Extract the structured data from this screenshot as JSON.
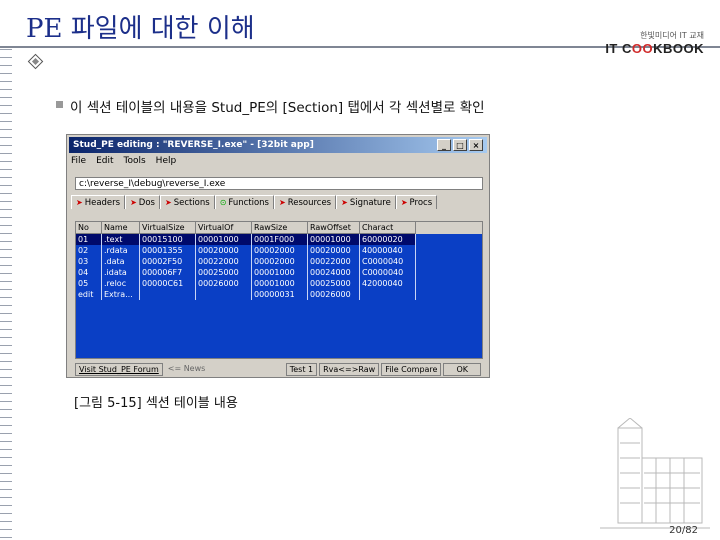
{
  "slide": {
    "title": "PE 파일에 대한 이해",
    "logo_sub": "한빛미디어 IT 교재",
    "logo_main_1": "IT C",
    "logo_main_o": "OO",
    "logo_main_2": "KBOOK",
    "bullet": "이 섹션 테이블의 내용을 Stud_PE의 [Section] 탭에서 각 섹션별로 확인",
    "caption": "[그림 5-15] 섹션 테이블 내용",
    "page": "20/82"
  },
  "window": {
    "title": "Stud_PE editing : \"REVERSE_I.exe\" - [32bit app]",
    "menu": [
      "File",
      "Edit",
      "Tools",
      "Help"
    ],
    "path": "c:\\reverse_I\\debug\\reverse_I.exe",
    "tabs": [
      {
        "icon": "headers-icon",
        "label": "Headers"
      },
      {
        "icon": "dos-icon",
        "label": "Dos"
      },
      {
        "icon": "sections-icon",
        "label": "Sections"
      },
      {
        "icon": "functions-icon",
        "label": "Functions"
      },
      {
        "icon": "resources-icon",
        "label": "Resources"
      },
      {
        "icon": "signature-icon",
        "label": "Signature"
      },
      {
        "icon": "procs-icon",
        "label": "Procs"
      }
    ],
    "columns": [
      "No",
      "Name",
      "VirtualSize",
      "VirtualOf",
      "RawSize",
      "RawOffset",
      "Charact"
    ],
    "rows": [
      [
        "01",
        ".text",
        "00015100",
        "00001000",
        "0001F000",
        "00001000",
        "60000020"
      ],
      [
        "02",
        ".rdata",
        "00001355",
        "00020000",
        "00002000",
        "00020000",
        "40000040"
      ],
      [
        "03",
        ".data",
        "00002F50",
        "00022000",
        "00002000",
        "00022000",
        "C0000040"
      ],
      [
        "04",
        ".idata",
        "000006F7",
        "00025000",
        "00001000",
        "00024000",
        "C0000040"
      ],
      [
        "05",
        ".reloc",
        "00000C61",
        "00026000",
        "00001000",
        "00025000",
        "42000040"
      ],
      [
        "edit",
        "Extra...",
        "",
        "",
        "00000031",
        "00026000",
        ""
      ]
    ],
    "bottom": {
      "forum": "Visit Stud_PE Forum",
      "news": "<= News",
      "test": "Test 1",
      "rva": "Rva<=>Raw",
      "compare": "File Compare",
      "ok": "OK"
    }
  }
}
